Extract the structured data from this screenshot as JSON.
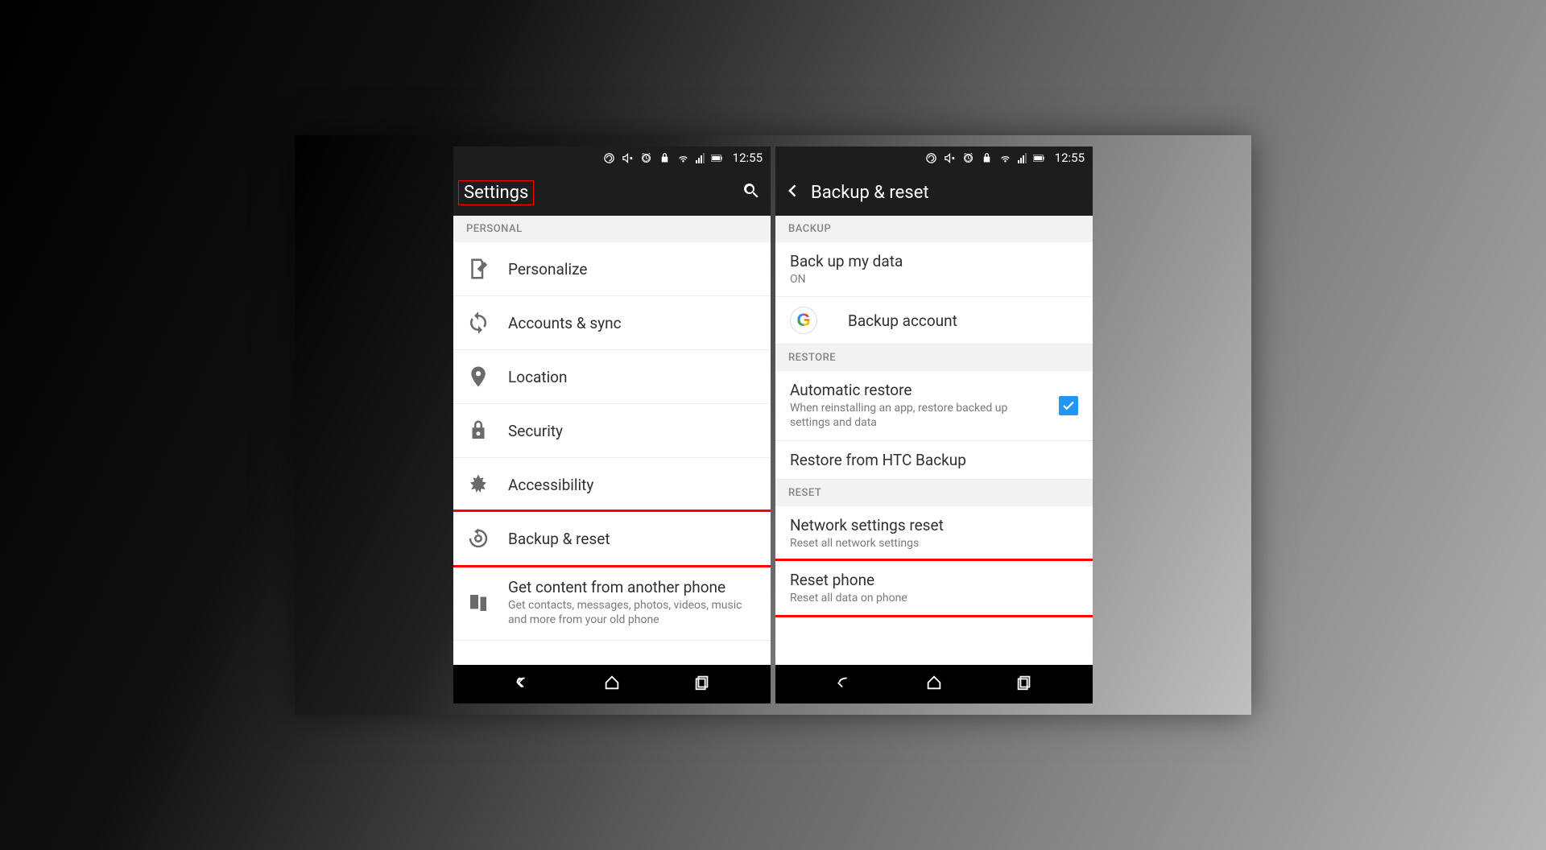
{
  "status": {
    "time": "12:55"
  },
  "screen1": {
    "title": "Settings",
    "section": "PERSONAL",
    "items": [
      {
        "label": "Personalize"
      },
      {
        "label": "Accounts & sync"
      },
      {
        "label": "Location"
      },
      {
        "label": "Security"
      },
      {
        "label": "Accessibility"
      },
      {
        "label": "Backup & reset"
      },
      {
        "label": "Get content from another phone",
        "sub": "Get contacts, messages, photos, videos, music and more from your old phone"
      }
    ]
  },
  "screen2": {
    "title": "Backup & reset",
    "sections": {
      "backup": {
        "header": "BACKUP",
        "backup_data": {
          "label": "Back up my data",
          "value": "ON"
        },
        "backup_account": {
          "label": "Backup account"
        }
      },
      "restore": {
        "header": "RESTORE",
        "auto_restore": {
          "label": "Automatic restore",
          "sub": "When reinstalling an app, restore backed up settings and data",
          "checked": true
        },
        "restore_htc": {
          "label": "Restore from HTC Backup"
        }
      },
      "reset": {
        "header": "RESET",
        "network_reset": {
          "label": "Network settings reset",
          "sub": "Reset all network settings"
        },
        "reset_phone": {
          "label": "Reset phone",
          "sub": "Reset all data on phone"
        }
      }
    }
  }
}
